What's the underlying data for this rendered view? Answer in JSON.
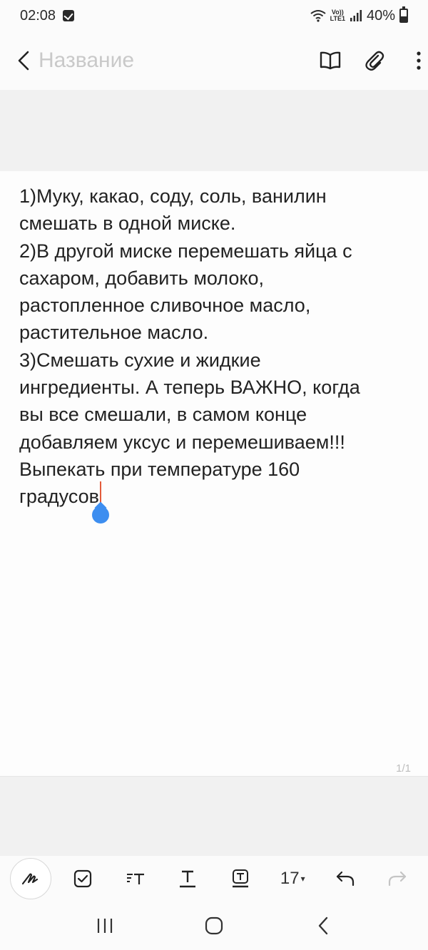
{
  "status_bar": {
    "time": "02:08",
    "network_top": "Vo))",
    "network_bottom": "LTE1",
    "battery": "40%"
  },
  "header": {
    "title_placeholder": "Название",
    "title_value": ""
  },
  "note": {
    "lines": [
      "1)Муку, какао, соду, соль, ванилин",
      "смешать в одной миске.",
      "2)В другой миске перемешать яйца с",
      "сахаром, добавить молоко,",
      "растопленное сливочное масло,",
      "растительное масло.",
      "3)Смешать сухие и жидкие",
      "ингредиенты. А теперь ВАЖНО,  когда",
      "вы все смешали, в самом конце",
      "добавляем уксус и перемешиваем!!!",
      "Выпекать при температуре 160",
      "градусов"
    ],
    "page_counter": "1/1"
  },
  "toolbar": {
    "font_size": "17",
    "font_size_arrow": "▾"
  },
  "icons": {
    "back": "chevron-left-icon",
    "reading_mode": "book-icon",
    "attach": "paperclip-icon",
    "more": "more-vertical-icon",
    "pen": "pen-icon",
    "checkbox": "checkbox-icon",
    "text_style": "text-style-icon",
    "underline": "underline-text-icon",
    "text_box": "text-box-icon",
    "undo": "undo-icon",
    "redo": "redo-icon",
    "recents": "recents-icon",
    "home": "home-icon",
    "nav_back": "nav-back-icon"
  },
  "colors": {
    "caret": "#e35b3b",
    "handle": "#3d8ef0"
  }
}
